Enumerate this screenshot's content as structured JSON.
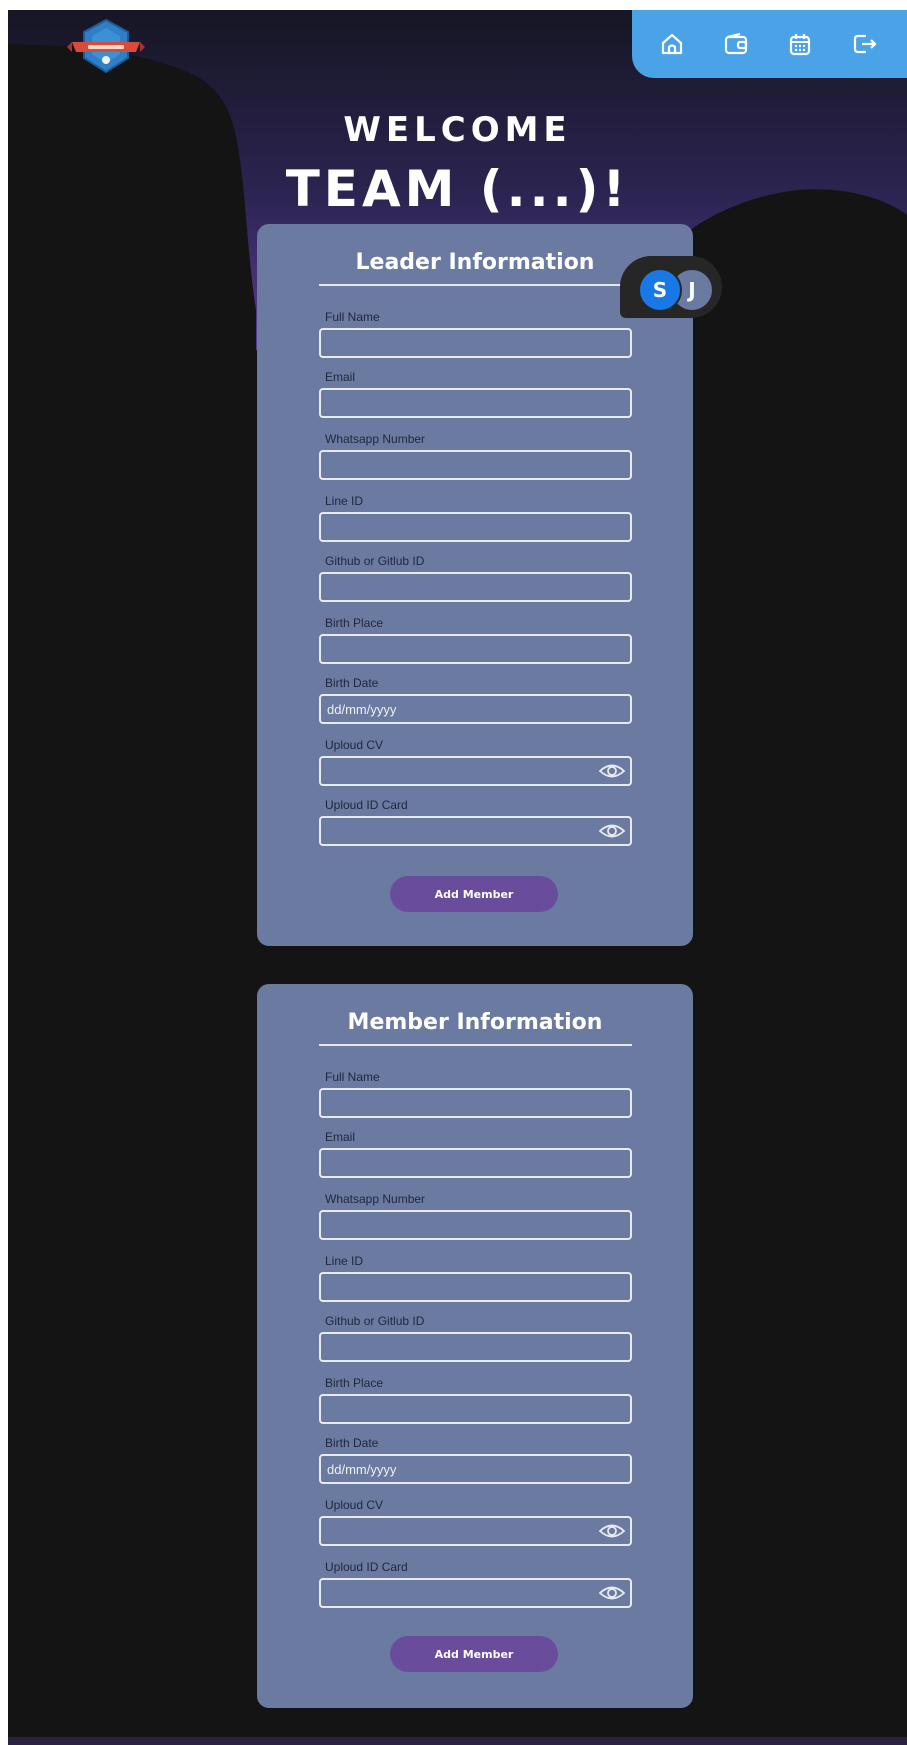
{
  "header": {
    "welcome": "WELCOME",
    "team_title": "TEAM (...)!"
  },
  "nav": {
    "items": [
      {
        "icon": "home-icon"
      },
      {
        "icon": "wallet-icon"
      },
      {
        "icon": "calendar-icon"
      },
      {
        "icon": "logout-icon"
      }
    ]
  },
  "avatars": {
    "first": "S",
    "second": "J",
    "first_color": "#1878e6",
    "second_color": "#6a7aa0"
  },
  "leader": {
    "title": "Leader Information",
    "full_name_label": "Full Name",
    "email_label": "Email",
    "whatsapp_label": "Whatsapp Number",
    "line_label": "Line ID",
    "github_label": "Github or Gitlub ID",
    "birth_place_label": "Birth Place",
    "birth_date_label": "Birth Date",
    "birth_date_placeholder": "dd/mm/yyyy",
    "cv_label": "Uploud CV",
    "id_card_label": "Uploud ID Card",
    "button_label": "Add Member"
  },
  "member": {
    "title": "Member Information",
    "full_name_label": "Full Name",
    "email_label": "Email",
    "whatsapp_label": "Whatsapp Number",
    "line_label": "Line ID",
    "github_label": "Github or Gitlub ID",
    "birth_place_label": "Birth Place",
    "birth_date_label": "Birth Date",
    "birth_date_placeholder": "dd/mm/yyyy",
    "cv_label": "Uploud CV",
    "id_card_label": "Uploud ID Card",
    "button_label": "Add Member"
  },
  "colors": {
    "background": "#141414",
    "nav_bar": "#4aa3e6",
    "card": "#6a7aa0",
    "button": "#6a4c9c",
    "gradient_purple": "#5b3a94"
  }
}
